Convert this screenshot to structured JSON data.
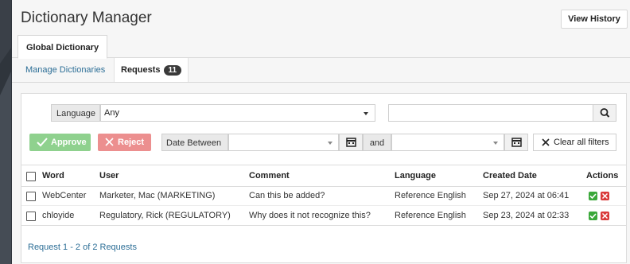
{
  "app": {
    "title": "Dictionary Manager",
    "view_history_label": "View History"
  },
  "tabs": {
    "global": "Global Dictionary"
  },
  "subtabs": {
    "manage": "Manage Dictionaries",
    "requests": "Requests",
    "requests_count": "11"
  },
  "filters": {
    "language_label": "Language",
    "language_value": "Any",
    "search_value": "",
    "approve_label": "Approve",
    "reject_label": "Reject",
    "date_between_label": "Date Between",
    "and_label": "and",
    "date_from_value": "",
    "date_to_value": "",
    "clear_label": "Clear all filters"
  },
  "table": {
    "headers": {
      "word": "Word",
      "user": "User",
      "comment": "Comment",
      "language": "Language",
      "created": "Created Date",
      "actions": "Actions"
    },
    "rows": [
      {
        "word": "WebCenter",
        "user": "Marketer, Mac (MARKETING)",
        "comment": "Can this be added?",
        "language": "Reference English",
        "created": "Sep 27, 2024 at 06:41"
      },
      {
        "word": "chloyide",
        "user": "Regulatory, Rick (REGULATORY)",
        "comment": "Why does it not recognize this?",
        "language": "Reference English",
        "created": "Sep 23, 2024 at 02:33"
      }
    ]
  },
  "footer": {
    "summary": "Request 1 - 2 of 2 Requests"
  },
  "colors": {
    "link": "#2c6e96",
    "approve": "#8fd18e",
    "reject": "#ec8f8f",
    "accept_icon": "#3aa83a",
    "reject_icon": "#d93a3a"
  }
}
